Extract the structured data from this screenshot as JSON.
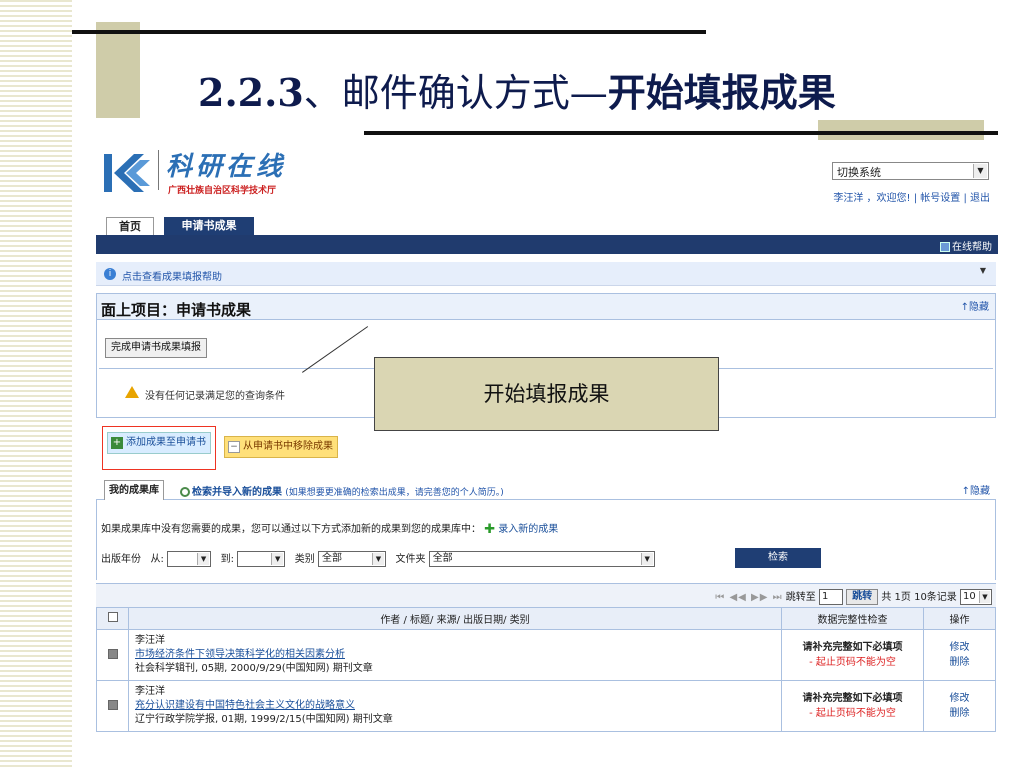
{
  "slide": {
    "title_number": "2.2.3",
    "title_mid": "、邮件确认方式—",
    "title_end": "开始填报成果",
    "callout": "开始填报成果"
  },
  "header": {
    "logo_name": "科研在线",
    "logo_sub": "广西壮族自治区科学技术厅",
    "system_select": "切换系统",
    "user_line": "李汪洋 ，欢迎您! | 帐号设置 | 退出"
  },
  "tabs": [
    {
      "label": "首页"
    },
    {
      "label": "申请书成果"
    }
  ],
  "navbar": {
    "help_online": "在线帮助"
  },
  "help_bar": {
    "text": "点击查看成果填报帮助"
  },
  "project_section": {
    "title": "面上项目：申请书成果",
    "hide": "↑隐藏",
    "complete_button": "完成申请书成果填报",
    "warning": "没有任何记录满足您的查询条件"
  },
  "actions": {
    "add": "添加成果至申请书",
    "remove": "从申请书中移除成果"
  },
  "library": {
    "tab_my": "我的成果库",
    "tab_search": "检索并导入新的成果",
    "tab_search_note": "(如果想要更准确的检索出成果，请完善您的个人简历。)",
    "hide": "↑隐藏",
    "add_line": "如果成果库中没有您需要的成果，您可以通过以下方式添加新的成果到您的成果库中：",
    "new_link": "录入新的成果",
    "filters": {
      "year_label": "出版年份",
      "from_label": "从:",
      "to_label": "到:",
      "category_label": "类别",
      "category_value": "全部",
      "folder_label": "文件夹",
      "folder_value": "全部"
    },
    "search_button": "检索"
  },
  "pager": {
    "arrows": "⏮ ◀◀ ▶▶ ⏭",
    "jump_label": "跳转至",
    "page_value": "1",
    "jump_button": "跳转",
    "summary": "共 1页 10条记录",
    "per_page": "10"
  },
  "table": {
    "headers": [
      "作者 / 标题/ 来源/ 出版日期/ 类别",
      "数据完整性检查",
      "操作"
    ],
    "rows": [
      {
        "author": "李汪洋",
        "title": "市场经济条件下领导决策科学化的相关因素分析",
        "source": "社会科学辑刊, 05期, 2000/9/29(中国知网) 期刊文章",
        "check_title": "请补充完整如下必填项",
        "check_detail": "- 起止页码不能为空",
        "edit": "修改",
        "delete": "删除"
      },
      {
        "author": "李汪洋",
        "title": "充分认识建设有中国特色社会主义文化的战略意义",
        "source": "辽宁行政学院学报, 01期, 1999/2/15(中国知网) 期刊文章",
        "check_title": "请补充完整如下必填项",
        "check_detail": "- 起止页码不能为空",
        "edit": "修改",
        "delete": "删除"
      }
    ]
  }
}
